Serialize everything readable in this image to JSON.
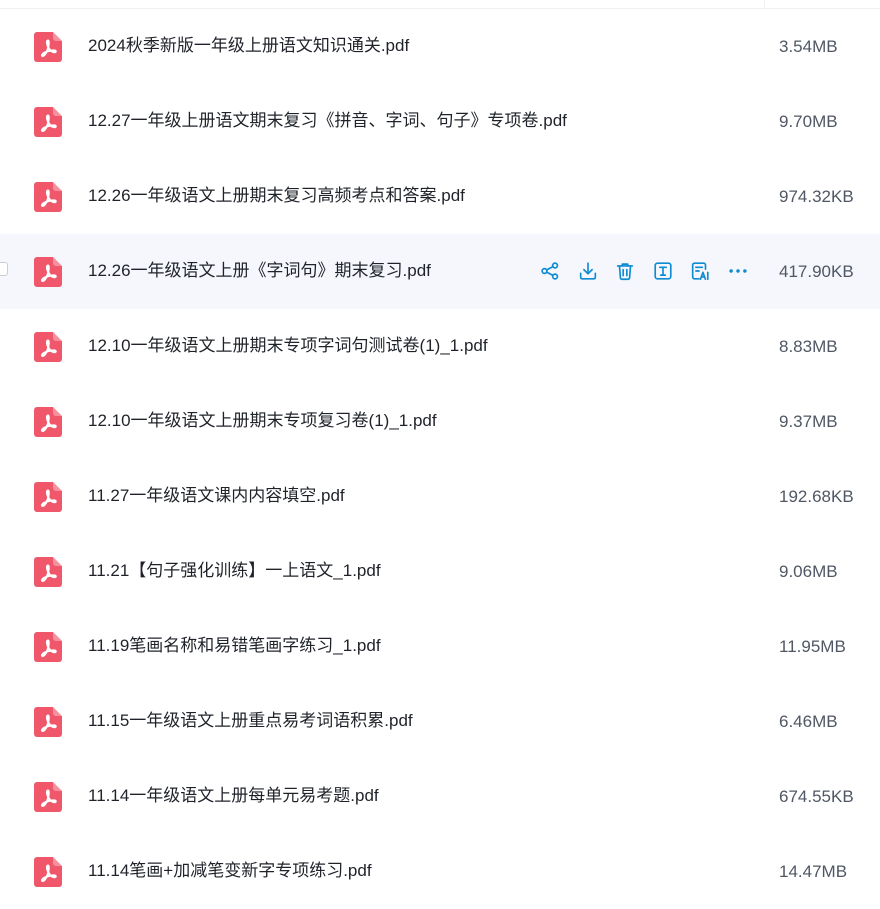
{
  "colors": {
    "accent": "#0d8bd3",
    "pdf_icon": "#f0576a",
    "text_primary": "#1f2329",
    "text_secondary": "#505764",
    "hover_row": "#f5f7fc"
  },
  "files": [
    {
      "name": "2024秋季新版一年级上册语文知识通关.pdf",
      "size": "3.54MB"
    },
    {
      "name": "12.27一年级上册语文期末复习《拼音、字词、句子》专项卷.pdf",
      "size": "9.70MB"
    },
    {
      "name": "12.26一年级语文上册期末复习高频考点和答案.pdf",
      "size": "974.32KB"
    },
    {
      "name": "12.26一年级语文上册《字词句》期末复习.pdf",
      "size": "417.90KB"
    },
    {
      "name": "12.10一年级语文上册期末专项字词句测试卷(1)_1.pdf",
      "size": "8.83MB"
    },
    {
      "name": "12.10一年级语文上册期末专项复习卷(1)_1.pdf",
      "size": "9.37MB"
    },
    {
      "name": "11.27一年级语文课内内容填空.pdf",
      "size": "192.68KB"
    },
    {
      "name": "11.21【句子强化训练】一上语文_1.pdf",
      "size": "9.06MB"
    },
    {
      "name": "11.19笔画名称和易错笔画字练习_1.pdf",
      "size": "11.95MB"
    },
    {
      "name": "11.15一年级语文上册重点易考词语积累.pdf",
      "size": "6.46MB"
    },
    {
      "name": "11.14一年级语文上册每单元易考题.pdf",
      "size": "674.55KB"
    },
    {
      "name": "11.14笔画+加减笔变新字专项练习.pdf",
      "size": "14.47MB"
    }
  ],
  "hovered_row_actions": [
    {
      "icon": "share-icon"
    },
    {
      "icon": "download-icon"
    },
    {
      "icon": "trash-icon"
    },
    {
      "icon": "text-extract-icon"
    },
    {
      "icon": "ai-document-icon"
    },
    {
      "icon": "more-icon"
    }
  ]
}
